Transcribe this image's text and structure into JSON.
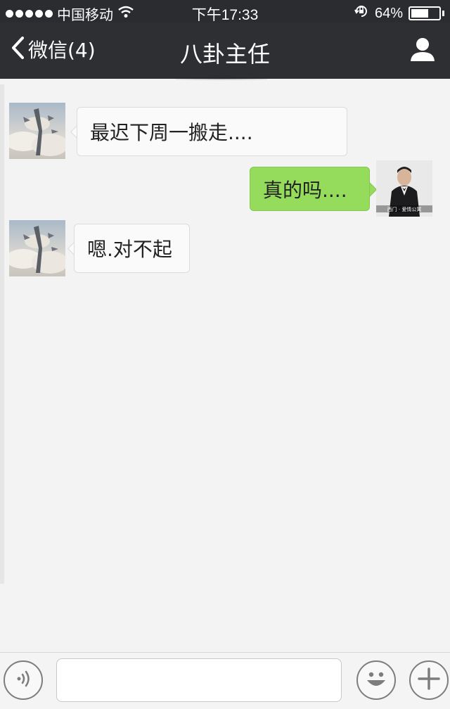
{
  "status_bar": {
    "carrier": "中国移动",
    "time": "下午17:33",
    "battery_percent": "64%",
    "battery_level": 0.64,
    "signal_dots": 5,
    "icons": [
      "signal-dots-icon",
      "wifi-icon",
      "rotation-lock-icon",
      "battery-icon"
    ]
  },
  "nav": {
    "back_label": "微信(4)",
    "title": "八卦主任",
    "back_icon": "chevron-left-icon",
    "contact_icon": "person-icon"
  },
  "messages": [
    {
      "side": "in",
      "text": "最迟下周一搬走...."
    },
    {
      "side": "out",
      "text": "真的吗....",
      "avatar_caption": "西门 · 爱情公寓"
    },
    {
      "side": "in",
      "text": "嗯.对不起"
    }
  ],
  "input_bar": {
    "voice_icon": "voice-icon",
    "emoji_icon": "emoji-icon",
    "plus_icon": "plus-icon",
    "message_value": "",
    "message_placeholder": ""
  },
  "colors": {
    "nav_bg": "#2e2f33",
    "outgoing_bubble": "#95dc5d",
    "incoming_bubble": "#fafafa",
    "chat_bg": "#f3f3f3"
  }
}
